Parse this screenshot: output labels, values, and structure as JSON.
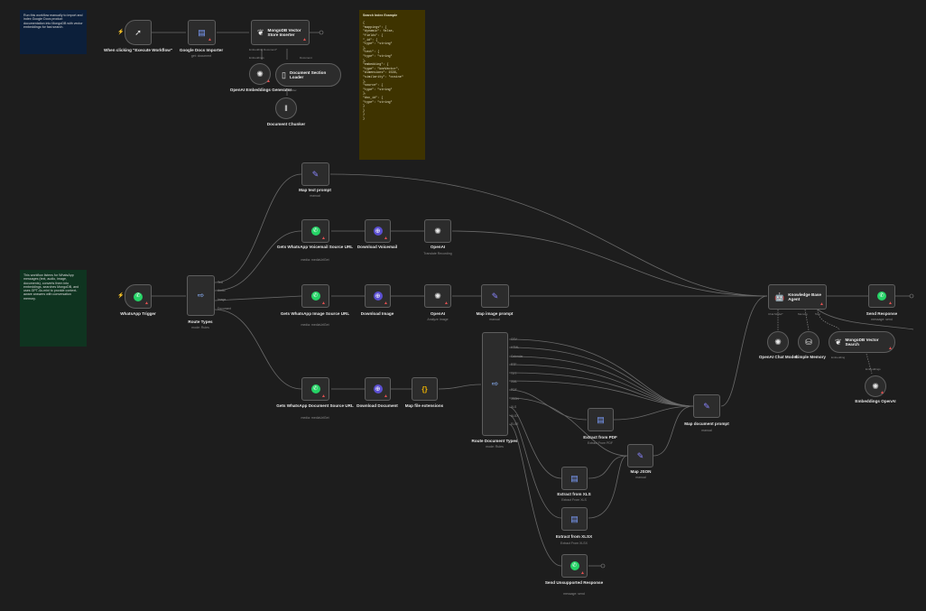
{
  "notes": {
    "top_blue": "Run this workflow manually to import and index Google Docs product documentation into MongoDB with vector embeddings for fast search.",
    "whatsapp_green": "This workflow listens for WhatsApp messages (text, audio, image, documents), converts them into embeddings, searches MongoDB, and uses GPT-4o-mini to provide context-aware answers with conversation memory.",
    "search_index_title": "Search Index Example",
    "search_index_code": "{\n\"mappings\": {\n\"dynamic\": false,\n\"fields\": {\n\"_id\": {\n\"type\": \"string\"\n},\n\"text\": {\n\"type\": \"string\"\n},\n\"embedding\": {\n\"type\": \"knnVector\",\n\"dimensions\": 1536,\n\"similarity\": \"cosine\"\n},\n\"source\": {\n\"type\": \"string\"\n},\n\"doc_id\": {\n\"type\": \"string\"\n}\n}\n}\n}"
  },
  "nodes": {
    "execute": {
      "label": "When clicking \"Execute Workflow\"",
      "icon": "cursor-icon"
    },
    "gdocs": {
      "label": "Google Docs Importer",
      "sub": "get: document",
      "icon": "google-docs-icon"
    },
    "mongo_insert": {
      "label": "MongoDB Vector Store Inserter",
      "icon": "mongodb-icon"
    },
    "openai_emb_gen": {
      "label": "OpenAI Embeddings Generator",
      "icon": "openai-icon"
    },
    "doc_loader": {
      "label": "Document Section Loader",
      "icon": "document-icon"
    },
    "chunker": {
      "label": "Document Chunker",
      "icon": "splitter-icon"
    },
    "map_text": {
      "label": "Map text prompt",
      "sub": "manual",
      "icon": "pen-icon"
    },
    "voicemail_url": {
      "label": "Gets WhatsApp Voicemail Source URL",
      "sub": "media: mediaUrlGet",
      "icon": "whatsapp-icon"
    },
    "download_voicemail": {
      "label": "Download Voicemail",
      "icon": "globe-icon"
    },
    "openai_transcribe": {
      "label": "OpenAI",
      "sub": "Translate Recording",
      "icon": "openai-icon"
    },
    "wa_trigger": {
      "label": "WhatsApp Trigger",
      "icon": "whatsapp-icon"
    },
    "route_types": {
      "label": "Route Types",
      "sub": "mode: Rules",
      "icon": "route-icon"
    },
    "image_url": {
      "label": "Gets WhatsApp Image Source URL",
      "sub": "media: mediaUrlGet",
      "icon": "whatsapp-icon"
    },
    "download_image": {
      "label": "Download Image",
      "icon": "globe-icon"
    },
    "openai_analyze": {
      "label": "OpenAI",
      "sub": "Analyze Image",
      "icon": "openai-icon"
    },
    "map_image": {
      "label": "Map image prompt",
      "sub": "manual",
      "icon": "pen-icon"
    },
    "agent": {
      "label": "Knowledge Base Agent",
      "icon": "robot-icon"
    },
    "send_response": {
      "label": "Send Response",
      "sub": "message: send",
      "icon": "whatsapp-icon"
    },
    "chat_model": {
      "label": "OpenAI Chat Model",
      "icon": "openai-icon"
    },
    "memory": {
      "label": "Simple Memory",
      "icon": "database-icon"
    },
    "mongo_search": {
      "label": "MongoDB Vector Search",
      "icon": "mongodb-icon"
    },
    "emb_openai": {
      "label": "Embeddings OpenAI",
      "icon": "openai-icon"
    },
    "doc_url": {
      "label": "Gets WhatsApp Document Source URL",
      "sub": "media: mediaUrlGet",
      "icon": "whatsapp-icon"
    },
    "download_doc": {
      "label": "Download Document",
      "icon": "globe-icon"
    },
    "map_ext": {
      "label": "Map file extensions",
      "icon": "json-icon"
    },
    "route_docs": {
      "label": "Route Document Types",
      "sub": "mode: Rules",
      "icon": "route-icon"
    },
    "extract_pdf": {
      "label": "Extract from PDF",
      "sub": "Extract From PDF",
      "icon": "extract-icon"
    },
    "map_doc": {
      "label": "Map document prompt",
      "sub": "manual",
      "icon": "pen-icon"
    },
    "map_json": {
      "label": "Map JSON",
      "sub": "manual",
      "icon": "pen-icon"
    },
    "extract_xls": {
      "label": "Extract from XLS",
      "sub": "Extract From XLS",
      "icon": "extract-icon"
    },
    "extract_xlsx": {
      "label": "Extract from XLSX",
      "sub": "Extract From XLSX",
      "icon": "extract-icon"
    },
    "unsupported": {
      "label": "Send Unsupported Response",
      "sub": "message: send",
      "icon": "whatsapp-icon"
    }
  },
  "ports": {
    "route_types_outputs": [
      "Text",
      "Audio",
      "Image",
      "Document"
    ],
    "route_docs_outputs": [
      "CSV",
      "HTML",
      "Calendar",
      "RTF",
      "TXT",
      "XML",
      "PDF",
      "JSON",
      "XLS",
      "XLSX",
      "ELSE"
    ],
    "mongo_insert_inputs": [
      "Embedding",
      "Document"
    ],
    "gen_document_sub": "Embeddings*",
    "text_splitter_label": "Text Splitter",
    "agent_inputs": [
      "Chat Model*",
      "Memory",
      "Tool"
    ],
    "mongo_search_inputs": [
      "Embedding"
    ],
    "emb_label": "Embeddings",
    "mongo_insert_bottom": "Embedding   Document*"
  }
}
